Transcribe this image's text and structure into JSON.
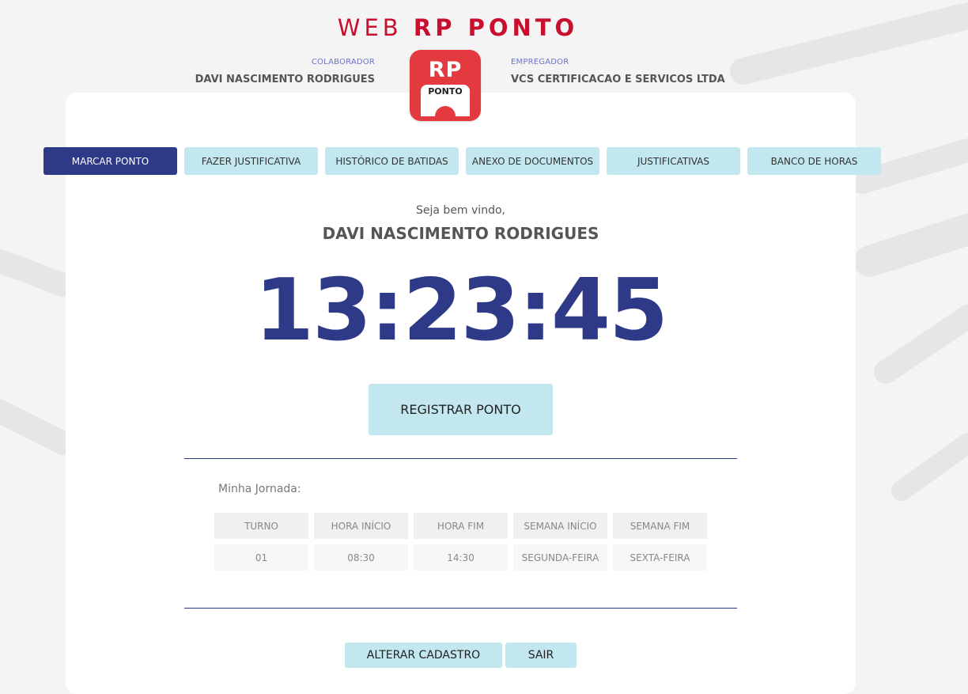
{
  "brand": {
    "light": "WEB",
    "bold": "RP PONTO"
  },
  "colaborador": {
    "label": "COLABORADOR",
    "name": "DAVI NASCIMENTO RODRIGUES"
  },
  "empregador": {
    "label": "EMPREGADOR",
    "name": "VCS CERTIFICACAO E SERVICOS LTDA"
  },
  "logo": {
    "top": "RP",
    "bottom": "PONTO"
  },
  "tabs": [
    {
      "label": "MARCAR PONTO",
      "active": true
    },
    {
      "label": "FAZER JUSTIFICATIVA"
    },
    {
      "label": "HISTÓRICO DE BATIDAS"
    },
    {
      "label": "ANEXO DE DOCUMENTOS"
    },
    {
      "label": "JUSTIFICATIVAS"
    },
    {
      "label": "BANCO DE HORAS"
    }
  ],
  "welcome": "Seja bem vindo,",
  "user_name": "DAVI NASCIMENTO RODRIGUES",
  "clock": "13:23:45",
  "register_label": "REGISTRAR PONTO",
  "jornada": {
    "label": "Minha Jornada:",
    "headers": [
      "TURNO",
      "HORA INÍCIO",
      "HORA FIM",
      "SEMANA INÍCIO",
      "SEMANA FIM"
    ],
    "rows": [
      [
        "01",
        "08:30",
        "14:30",
        "SEGUNDA-FEIRA",
        "SEXTA-FEIRA"
      ]
    ]
  },
  "actions": {
    "edit": "ALTERAR CADASTRO",
    "exit": "SAIR"
  },
  "colors": {
    "primary": "#2e3a87",
    "accent": "#c2e7ef",
    "brand_red": "#c8102e"
  }
}
